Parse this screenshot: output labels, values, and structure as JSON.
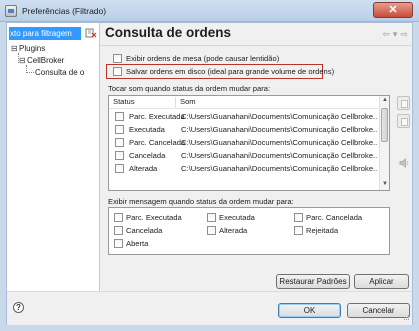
{
  "window": {
    "title": "Preferências (Filtrado)",
    "close_glyph": "✕"
  },
  "filter": {
    "value": "xto para filtragem"
  },
  "tree": {
    "toggle_expanded": "⊟",
    "items": [
      "Plugins",
      "CellBroker",
      "Consulta de o"
    ]
  },
  "page": {
    "title": "Consulta de ordens",
    "nav_back": "⇦",
    "nav_down": "▾",
    "nav_forward": "⇨"
  },
  "options": {
    "show_desk_orders": "Exibir ordens de mesa (pode causar lentidão)",
    "save_orders_disk": "Salvar ordens em disco (ideal para grande volume de ordens)"
  },
  "sound_section": {
    "label": "Tocar som quando status da ordem mudar para:",
    "headers": {
      "status": "Status",
      "sound": "Som"
    },
    "rows": [
      {
        "status": "Parc. Executada",
        "sound": "C:\\Users\\Guanahani\\Documents\\Comunicação Cellbroke..."
      },
      {
        "status": "Executada",
        "sound": "C:\\Users\\Guanahani\\Documents\\Comunicação Cellbroke..."
      },
      {
        "status": "Parc. Cancelada",
        "sound": "C:\\Users\\Guanahani\\Documents\\Comunicação Cellbroke..."
      },
      {
        "status": "Cancelada",
        "sound": "C:\\Users\\Guanahani\\Documents\\Comunicação Cellbroke..."
      },
      {
        "status": "Alterada",
        "sound": "C:\\Users\\Guanahani\\Documents\\Comunicação Cellbroke..."
      }
    ]
  },
  "message_section": {
    "label": "Exibir mensagem quando status da ordem mudar para:",
    "items": [
      "Parc. Executada",
      "Executada",
      "Parc. Cancelada",
      "Cancelada",
      "Alterada",
      "Rejeitada",
      "Aberta"
    ]
  },
  "buttons": {
    "restore_defaults": "Restaurar Padrões",
    "apply": "Aplicar",
    "ok": "OK",
    "cancel": "Cancelar"
  },
  "help": {
    "glyph": "?"
  }
}
